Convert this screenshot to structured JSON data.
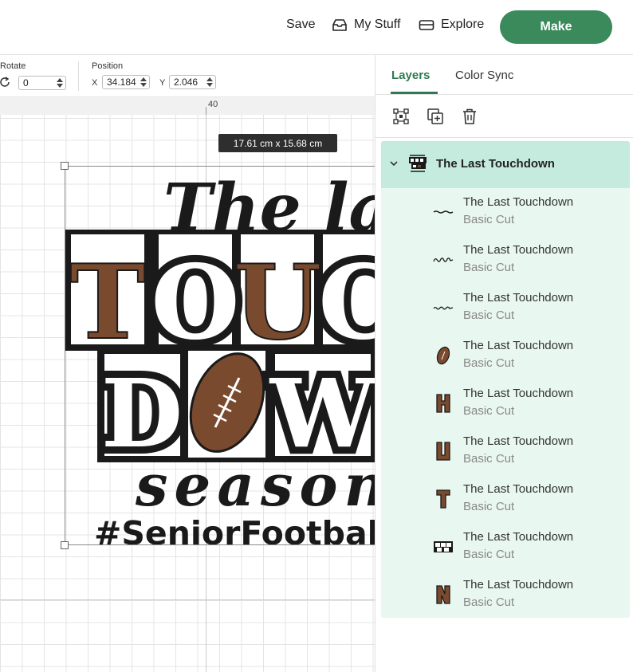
{
  "topbar": {
    "save_label": "Save",
    "mystuff_label": "My Stuff",
    "explore_label": "Explore",
    "make_label": "Make"
  },
  "toolbar": {
    "rotate_label": "Rotate",
    "rotate_value": "0",
    "position_label": "Position",
    "x_label": "X",
    "x_value": "34.184",
    "y_label": "Y",
    "y_value": "2.046"
  },
  "ruler": {
    "mark": "40"
  },
  "canvas": {
    "dimension_tag": "17.61  cm x 15.68  cm",
    "artwork": {
      "line1": "The last",
      "row1_letters": [
        "T",
        "O",
        "U",
        "C"
      ],
      "row2_letters": [
        "D",
        "W"
      ],
      "line3": "season",
      "line4": "#SeniorFootball"
    }
  },
  "panel": {
    "tabs": [
      {
        "label": "Layers",
        "active": true
      },
      {
        "label": "Color Sync",
        "active": false
      }
    ],
    "group": {
      "title": "The Last Touchdown"
    },
    "layers": [
      {
        "name": "The Last Touchdown",
        "type": "Basic Cut",
        "thumb": "line-thumb"
      },
      {
        "name": "The Last Touchdown",
        "type": "Basic Cut",
        "thumb": "script-thumb"
      },
      {
        "name": "The Last Touchdown",
        "type": "Basic Cut",
        "thumb": "season-thumb"
      },
      {
        "name": "The Last Touchdown",
        "type": "Basic Cut",
        "thumb": "football-thumb"
      },
      {
        "name": "The Last Touchdown",
        "type": "Basic Cut",
        "thumb": "h-letter-thumb"
      },
      {
        "name": "The Last Touchdown",
        "type": "Basic Cut",
        "thumb": "u-letter-thumb"
      },
      {
        "name": "The Last Touchdown",
        "type": "Basic Cut",
        "thumb": "t-letter-thumb"
      },
      {
        "name": "The Last Touchdown",
        "type": "Basic Cut",
        "thumb": "boxes-thumb"
      },
      {
        "name": "The Last Touchdown",
        "type": "Basic Cut",
        "thumb": "n-letter-thumb"
      }
    ]
  },
  "colors": {
    "accent": "#2f7a52",
    "make_button": "#3a8a5c",
    "group_header": "#c5ebde",
    "group_body": "#e9f7f1",
    "football_brown": "#7a4a2e"
  }
}
